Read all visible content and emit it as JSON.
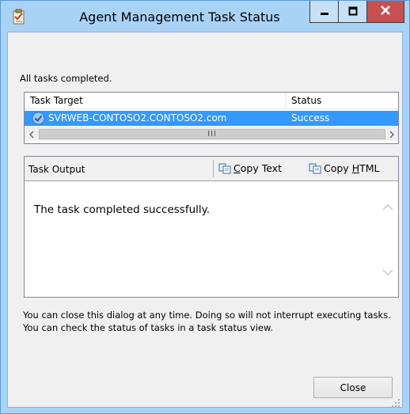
{
  "window": {
    "title": "Agent Management Task Status",
    "controls": {
      "minimize_icon": "minimize-icon",
      "maximize_icon": "maximize-icon",
      "close_icon": "close-icon"
    },
    "colors": {
      "frame": "#a9d3f5",
      "client": "#f0f0f0",
      "close_button": "#c75050"
    }
  },
  "summary": {
    "text": "All tasks completed."
  },
  "task_list": {
    "columns": [
      "Task Target",
      "Status"
    ],
    "rows": [
      {
        "target": "SVRWEB-CONTOSO2.CONTOSO2.com",
        "status": "Success",
        "icon": "success-check-icon",
        "selected": true
      }
    ],
    "selection_color": "#3399ff",
    "scrollbar_thumb": "III"
  },
  "output": {
    "label": "Task Output",
    "copy_text_label": "Copy Text",
    "copy_text_mnemonic": "C",
    "copy_html_label": "Copy HTML",
    "copy_html_mnemonic": "H",
    "body_text": "The task completed successfully."
  },
  "help": {
    "text": "You can close this dialog at any time. Doing so will not interrupt executing tasks. You can check the status of tasks in a task status view."
  },
  "buttons": {
    "close_label": "Close"
  }
}
